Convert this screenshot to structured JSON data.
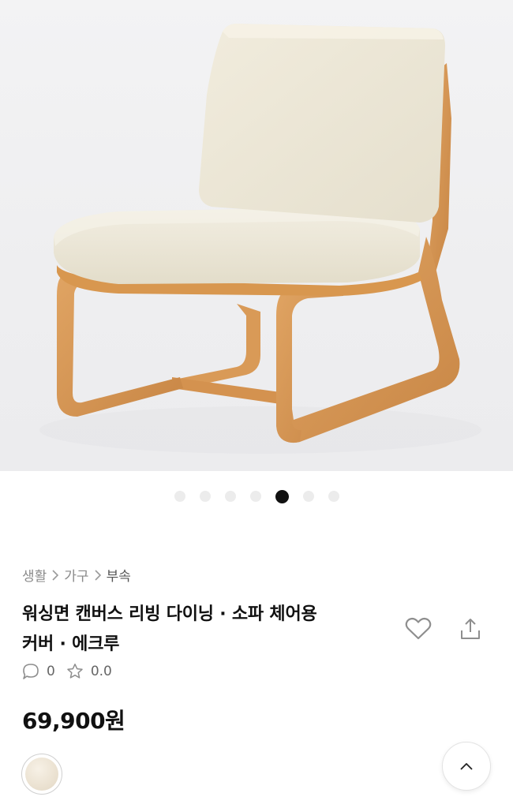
{
  "product": {
    "image": {
      "alt": "",
      "slides_total": 7,
      "active_slide": 5
    },
    "breadcrumb": [
      "생활",
      "가구",
      "부속"
    ],
    "title_line1": "워싱면 캔버스 리빙 다이닝 · 소파 체어용",
    "title_line2": "커버 · 에크루",
    "comments_count": "0",
    "rating": "0.0",
    "price": "69,900원",
    "swatch_color": "#ece3d3"
  },
  "icons": {
    "favorite": "heart-icon",
    "share": "share-icon",
    "comment": "comment-icon",
    "rating": "star-icon",
    "scroll_top": "chevron-up-icon",
    "breadcrumb_sep": "chevron-right-icon"
  },
  "colors": {
    "accent": "#111111",
    "muted": "#8a8a8a"
  }
}
